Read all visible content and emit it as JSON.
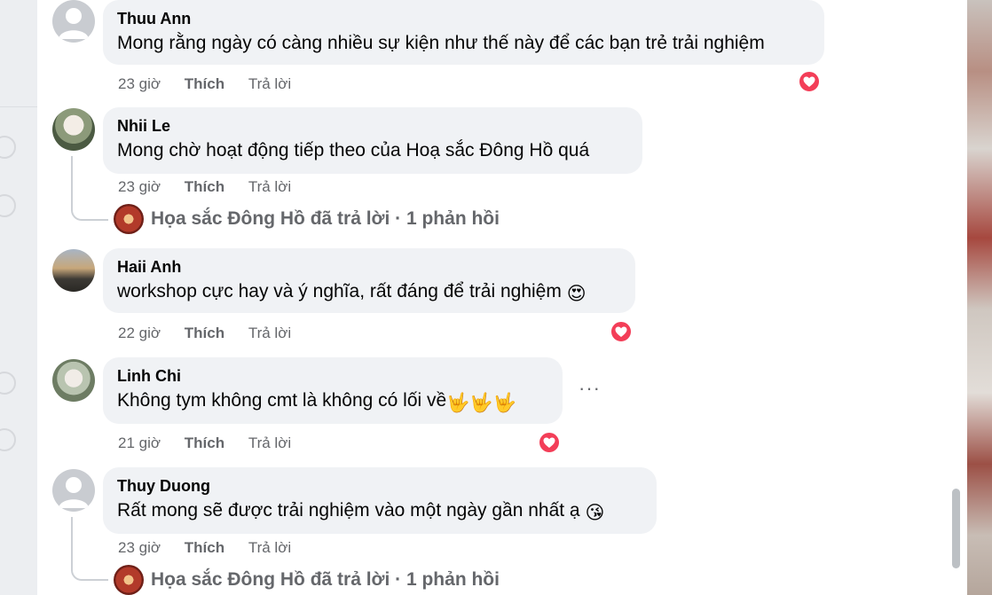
{
  "comments": [
    {
      "author": "Thuu Ann",
      "text": "Mong rằng ngày có càng nhiều sự kiện như thế này để các bạn trẻ trải nghiệm",
      "time": "23 giờ",
      "like_label": "Thích",
      "reply_label": "Trả lời",
      "avatar": "default-avatar",
      "reaction": "heart-icon"
    },
    {
      "author": "Nhii Le",
      "text": "Mong chờ hoạt động tiếp theo của Hoạ sắc Đông Hồ quá",
      "time": "23 giờ",
      "like_label": "Thích",
      "reply_label": "Trả lời",
      "avatar": "photo-avatar",
      "reply_summary": "Họa sắc Đông Hồ đã trả lời · 1 phản hồi"
    },
    {
      "author": "Haii Anh",
      "text": "workshop cực hay và ý nghĩa, rất đáng để trải nghiệm",
      "emoji": "😍",
      "time": "22 giờ",
      "like_label": "Thích",
      "reply_label": "Trả lời",
      "avatar": "photo-avatar",
      "reaction": "heart-icon"
    },
    {
      "author": "Linh Chi",
      "text": "Không tym không cmt là không có lối về",
      "emoji": "🤟🤟🤟",
      "time": "21 giờ",
      "like_label": "Thích",
      "reply_label": "Trả lời",
      "avatar": "photo-avatar",
      "reaction": "heart-icon",
      "more": "···"
    },
    {
      "author": "Thuy Duong",
      "text": "Rất mong sẽ được trải nghiệm vào một ngày gần nhất ạ",
      "emoji": "😘",
      "time": "23 giờ",
      "like_label": "Thích",
      "reply_label": "Trả lời",
      "avatar": "default-avatar",
      "reply_summary": "Họa sắc Đông Hồ đã trả lời · 1 phản hồi"
    }
  ],
  "colors": {
    "bubble": "#f0f2f5",
    "meta_text": "#65676b",
    "heart": "#f33e58"
  }
}
